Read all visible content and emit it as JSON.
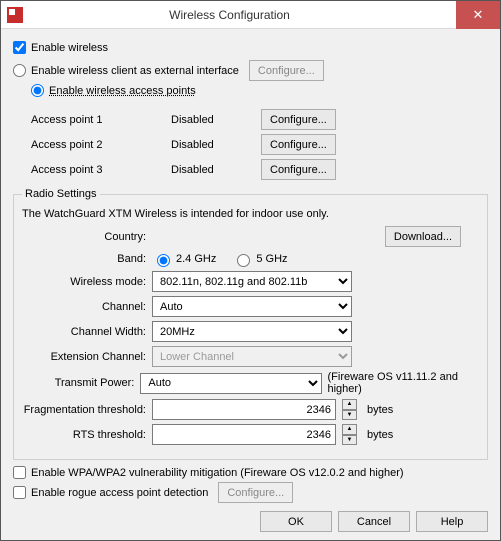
{
  "window": {
    "title": "Wireless Configuration"
  },
  "enable_wireless": {
    "label": "Enable wireless",
    "checked": true
  },
  "mode": {
    "client": {
      "label": "Enable wireless client as external interface",
      "selected": false,
      "configure": "Configure..."
    },
    "ap": {
      "label": "Enable wireless access points",
      "selected": true
    }
  },
  "aps": [
    {
      "name": "Access point 1",
      "status": "Disabled",
      "btn": "Configure..."
    },
    {
      "name": "Access point 2",
      "status": "Disabled",
      "btn": "Configure..."
    },
    {
      "name": "Access point 3",
      "status": "Disabled",
      "btn": "Configure..."
    }
  ],
  "radio": {
    "legend": "Radio Settings",
    "note": "The WatchGuard XTM Wireless is intended for indoor use only.",
    "country_label": "Country:",
    "download": "Download...",
    "band_label": "Band:",
    "band_24": "2.4 GHz",
    "band_5": "5 GHz",
    "mode_label": "Wireless mode:",
    "mode_value": "802.11n, 802.11g and 802.11b",
    "channel_label": "Channel:",
    "channel_value": "Auto",
    "width_label": "Channel Width:",
    "width_value": "20MHz",
    "ext_label": "Extension Channel:",
    "ext_value": "Lower Channel",
    "power_label": "Transmit Power:",
    "power_value": "Auto",
    "power_hint": "(Fireware OS v11.11.2 and higher)",
    "frag_label": "Fragmentation threshold:",
    "frag_value": "2346",
    "rts_label": "RTS threshold:",
    "rts_value": "2346",
    "bytes": "bytes"
  },
  "wpa_mitigation": {
    "label": "Enable WPA/WPA2 vulnerability mitigation (Fireware OS v12.0.2 and higher)",
    "checked": false
  },
  "rogue": {
    "label": "Enable rogue access point detection",
    "checked": false,
    "btn": "Configure..."
  },
  "buttons": {
    "ok": "OK",
    "cancel": "Cancel",
    "help": "Help"
  }
}
